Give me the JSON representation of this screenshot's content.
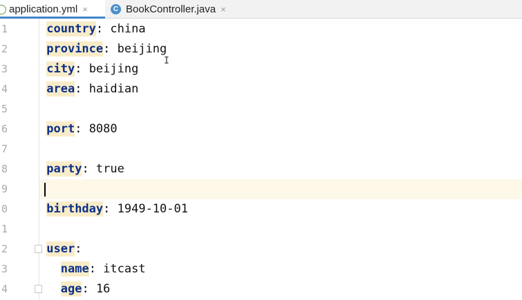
{
  "tabs": [
    {
      "label": "application.yml",
      "close": "×",
      "active": true,
      "icon": "yaml-file-icon"
    },
    {
      "label": "BookController.java",
      "close": "×",
      "active": false,
      "icon": "java-class-icon",
      "icon_letter": "C"
    }
  ],
  "gutter": {
    "line_numbers": [
      "1",
      "2",
      "3",
      "4",
      "5",
      "6",
      "7",
      "8",
      "9",
      "0",
      "1",
      "2",
      "3",
      "4"
    ]
  },
  "editor": {
    "lines": [
      {
        "indent": "",
        "key": "country",
        "sep": ": ",
        "value": "china"
      },
      {
        "indent": "",
        "key": "province",
        "sep": ": ",
        "value": "beijing"
      },
      {
        "indent": "",
        "key": "city",
        "sep": ": ",
        "value": "beijing"
      },
      {
        "indent": "",
        "key": "area",
        "sep": ": ",
        "value": "haidian"
      },
      {
        "indent": "",
        "key": "",
        "sep": "",
        "value": ""
      },
      {
        "indent": "",
        "key": "port",
        "sep": ": ",
        "value": "8080"
      },
      {
        "indent": "",
        "key": "",
        "sep": "",
        "value": ""
      },
      {
        "indent": "",
        "key": "party",
        "sep": ": ",
        "value": "true"
      },
      {
        "indent": "",
        "key": "",
        "sep": "",
        "value": ""
      },
      {
        "indent": "",
        "key": "birthday",
        "sep": ": ",
        "value": "1949-10-01"
      },
      {
        "indent": "",
        "key": "",
        "sep": "",
        "value": ""
      },
      {
        "indent": "",
        "key": "user",
        "sep": ":",
        "value": ""
      },
      {
        "indent": "  ",
        "key": "name",
        "sep": ": ",
        "value": "itcast"
      },
      {
        "indent": "  ",
        "key": "age",
        "sep": ": ",
        "value": "16"
      }
    ],
    "current_line": 9
  },
  "colors": {
    "key": "#0b2e87",
    "key_highlight": "#f8ecc8",
    "current_line": "#fdf8e8",
    "tab_underline": "#4083c9"
  }
}
